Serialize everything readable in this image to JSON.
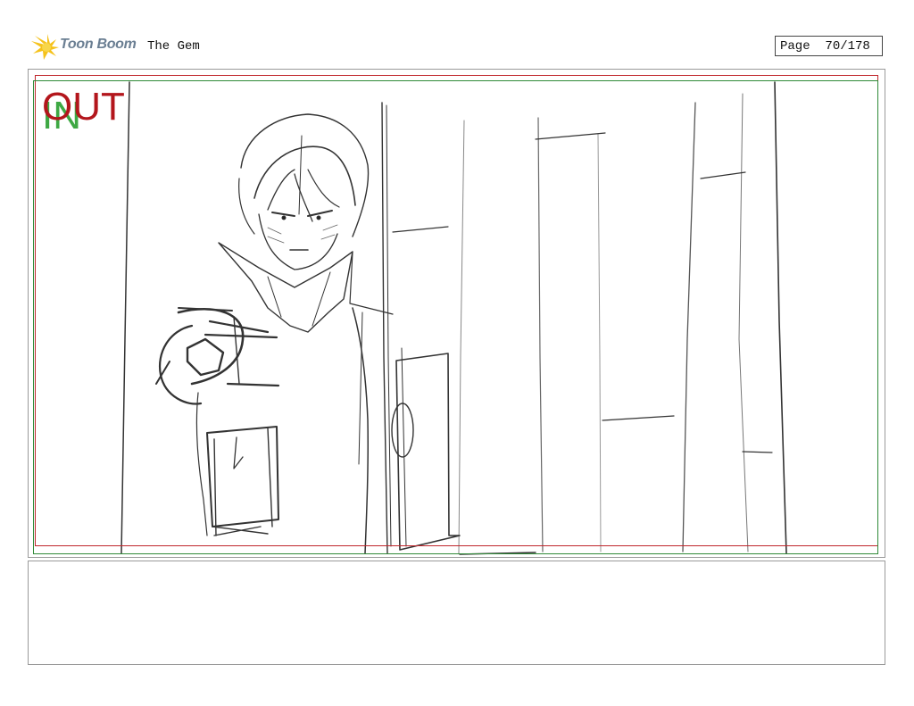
{
  "header": {
    "logo_text": "Toon Boom",
    "project_title": "The Gem",
    "page_label": "Page",
    "page_number": "70/178"
  },
  "panel": {
    "in_label": "IN",
    "out_label": "OUT",
    "colors": {
      "in_frame": "#2f8a37",
      "out_frame": "#c0262c"
    }
  },
  "notes": {
    "text": ""
  }
}
